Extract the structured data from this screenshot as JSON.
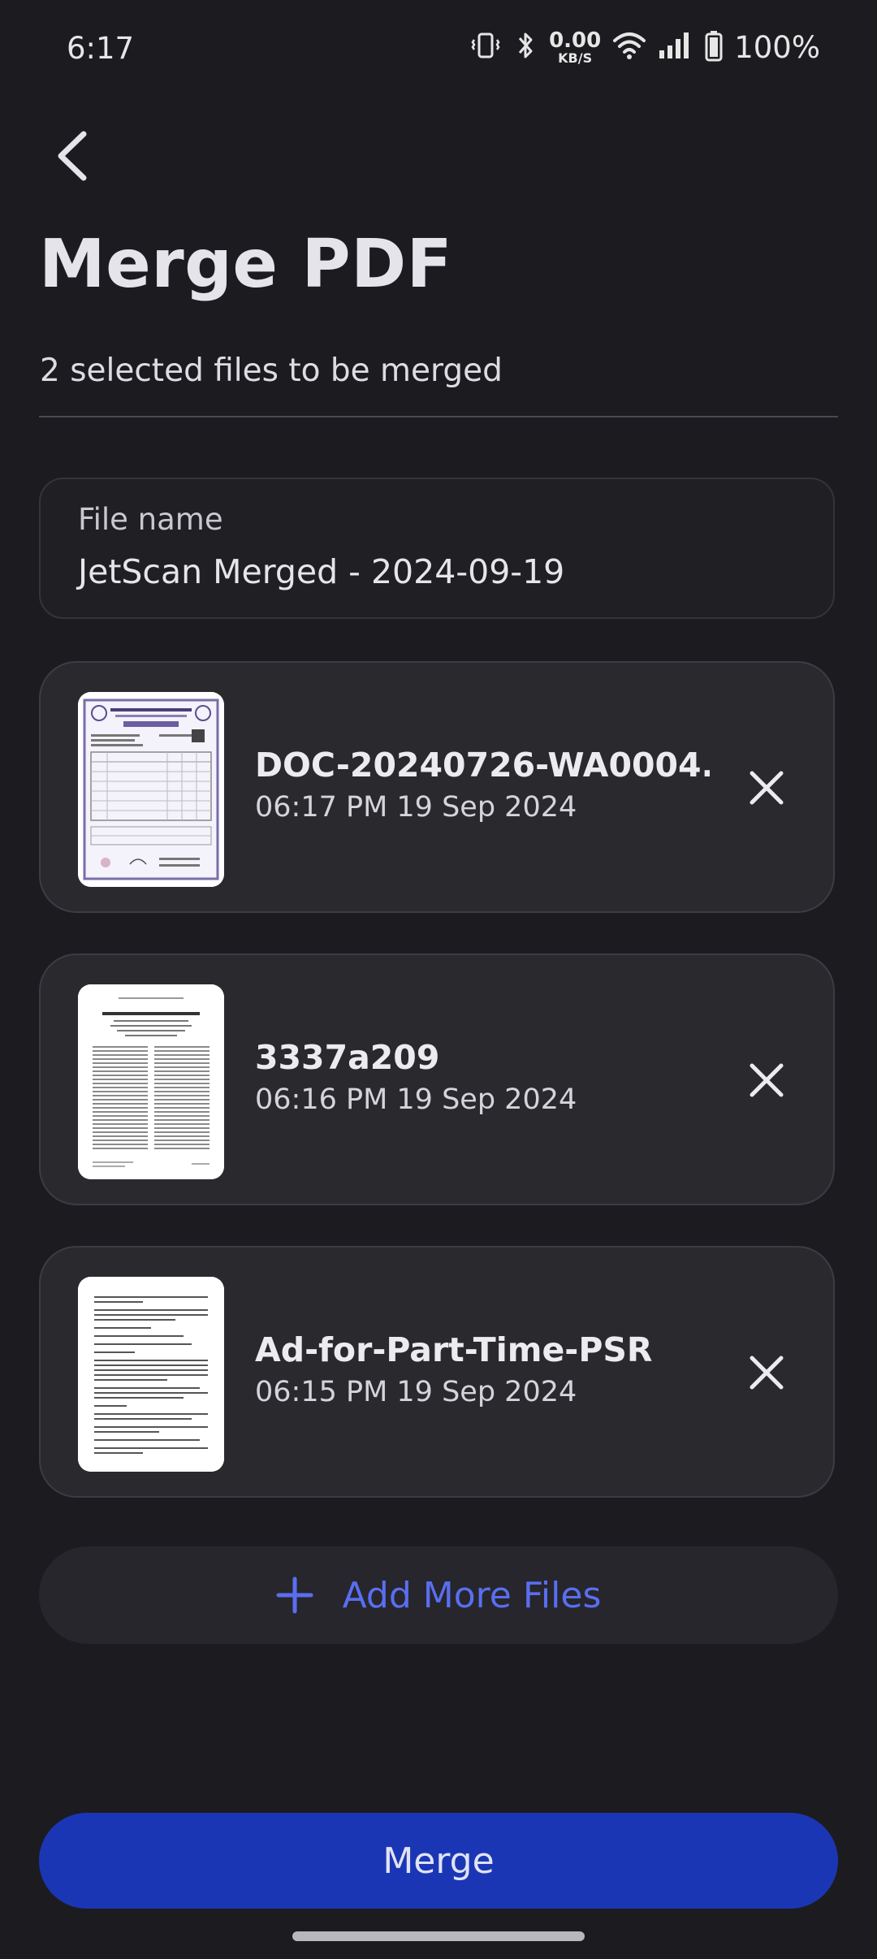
{
  "status_bar": {
    "time": "6:17",
    "net_speed_value": "0.00",
    "net_speed_unit": "KB/S",
    "battery_percent": "100%"
  },
  "header": {
    "title": "Merge PDF",
    "subtitle": "2 selected files to be merged"
  },
  "filename_field": {
    "label": "File name",
    "value": "JetScan Merged - 2024-09-19"
  },
  "files": [
    {
      "name": "DOC-20240726-WA0004.",
      "date": "06:17 PM 19 Sep 2024"
    },
    {
      "name": "3337a209",
      "date": "06:16 PM 19 Sep 2024"
    },
    {
      "name": "Ad-for-Part-Time-PSR",
      "date": "06:15 PM 19 Sep 2024"
    }
  ],
  "actions": {
    "add_more_label": "Add More Files",
    "merge_label": "Merge"
  },
  "colors": {
    "background": "#1c1c20",
    "accent": "#5a6ef0",
    "primary_button": "#1b36b5",
    "card": "#29292e"
  }
}
